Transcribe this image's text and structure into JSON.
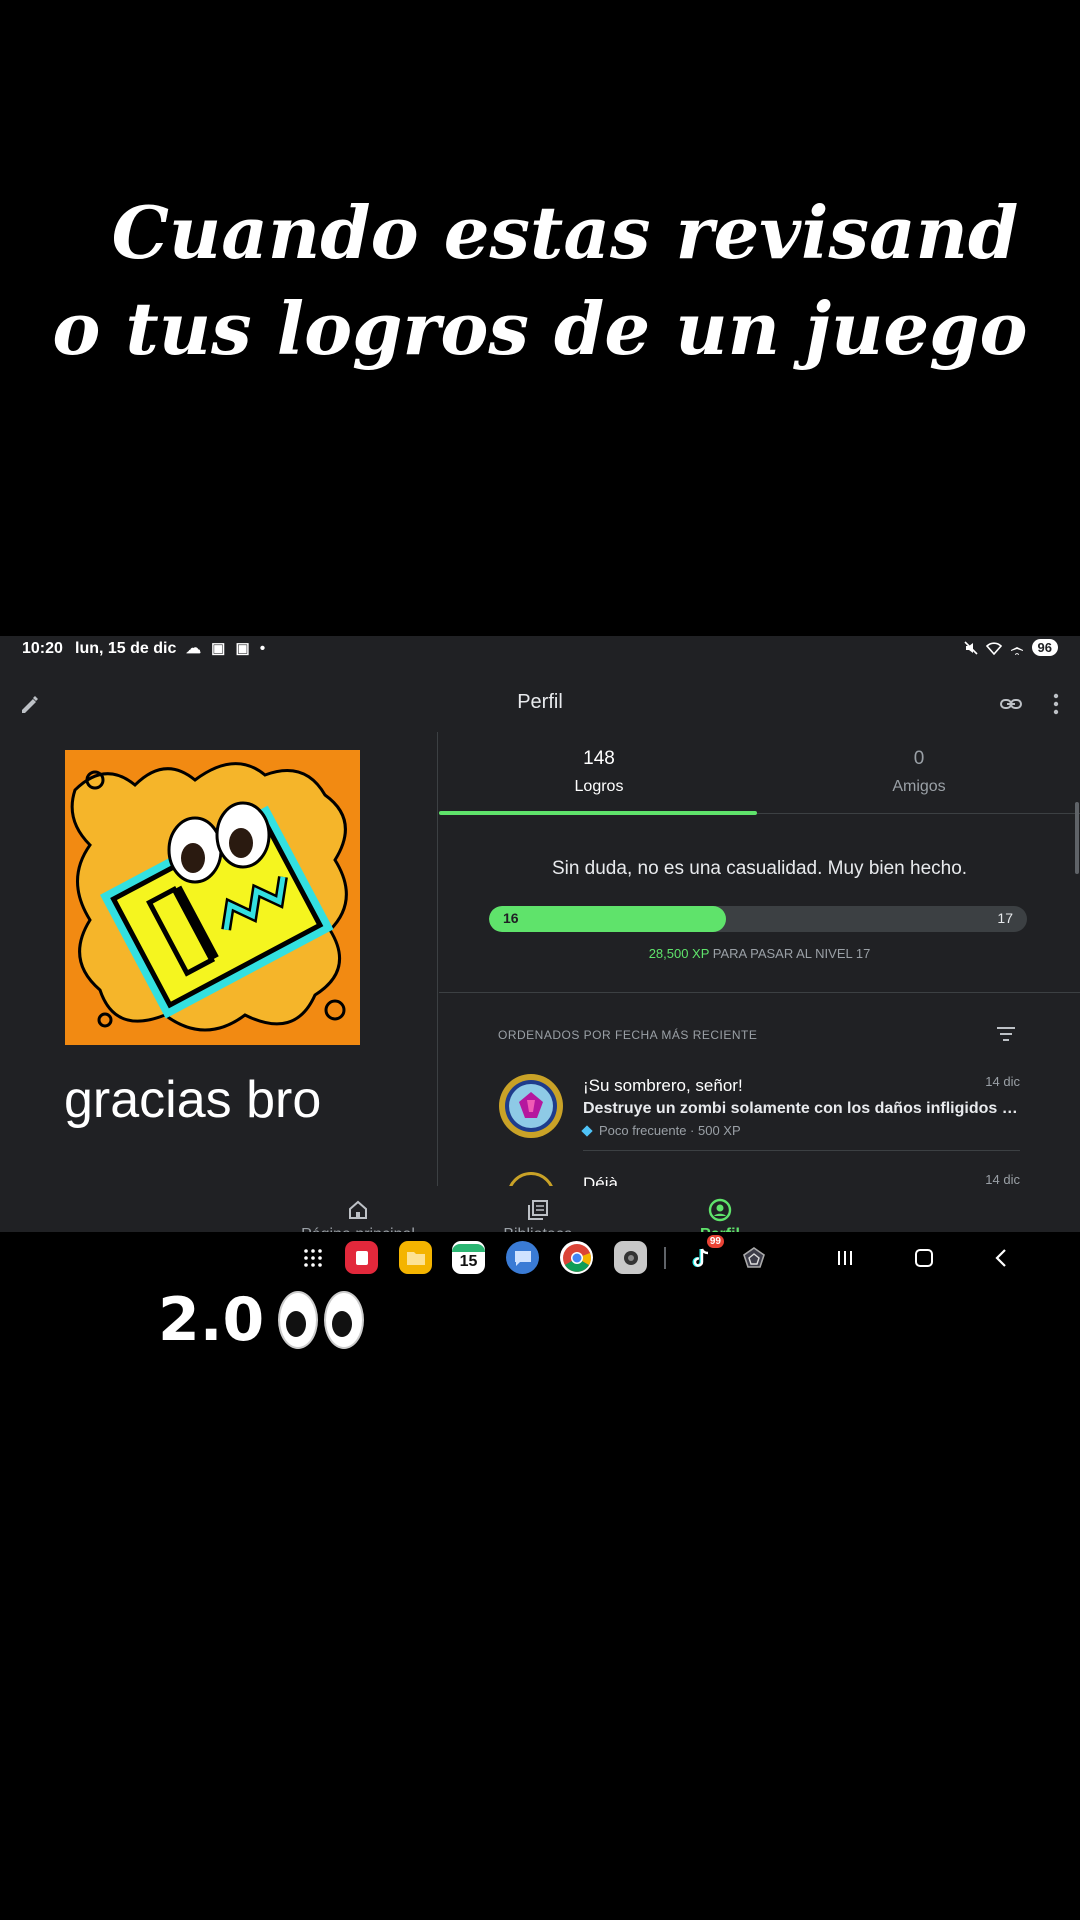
{
  "caption": {
    "line1": "Cuando estas revisand",
    "line2": "o tus logros de un juego"
  },
  "statusbar": {
    "time": "10:20",
    "date": "lun, 15 de dic",
    "battery": "96"
  },
  "appbar": {
    "title": "Perfil",
    "edit_icon": "pencil-icon",
    "link_icon": "link-icon",
    "more_icon": "more-vert-icon"
  },
  "profile": {
    "username": "gracias bro"
  },
  "tabs": [
    {
      "count": "148",
      "label": "Logros",
      "active": true
    },
    {
      "count": "0",
      "label": "Amigos",
      "active": false
    }
  ],
  "level": {
    "message": "Sin duda, no es una casualidad. Muy bien hecho.",
    "current": "16",
    "next": "17",
    "progress_fraction": 0.44,
    "xp_amount": "28,500 XP",
    "xp_text": " PARA PASAR AL NIVEL 17"
  },
  "achievements": {
    "sort_label": "ORDENADOS POR FECHA MÁS RECIENTE",
    "items": [
      {
        "title": "¡Su sombrero, señor!",
        "date": "14 dic",
        "description": "Destruye un zombi solamente con los daños infligidos por ...",
        "meta": "Poco frecuente · 500 XP"
      },
      {
        "title": "Déjà ...",
        "date": "14 dic"
      }
    ]
  },
  "bottomnav": [
    {
      "label": "Página principal",
      "icon": "home-icon",
      "active": false
    },
    {
      "label": "Biblioteca",
      "icon": "library-icon",
      "active": false
    },
    {
      "label": "Perfil",
      "icon": "account-circle-icon",
      "active": true
    }
  ],
  "taskbar": {
    "calendar_day": "15",
    "tiktok_badge": "99"
  },
  "bottom_caption": {
    "text": "2.0"
  },
  "colors": {
    "accent": "#5fe36b",
    "background": "#202124"
  }
}
